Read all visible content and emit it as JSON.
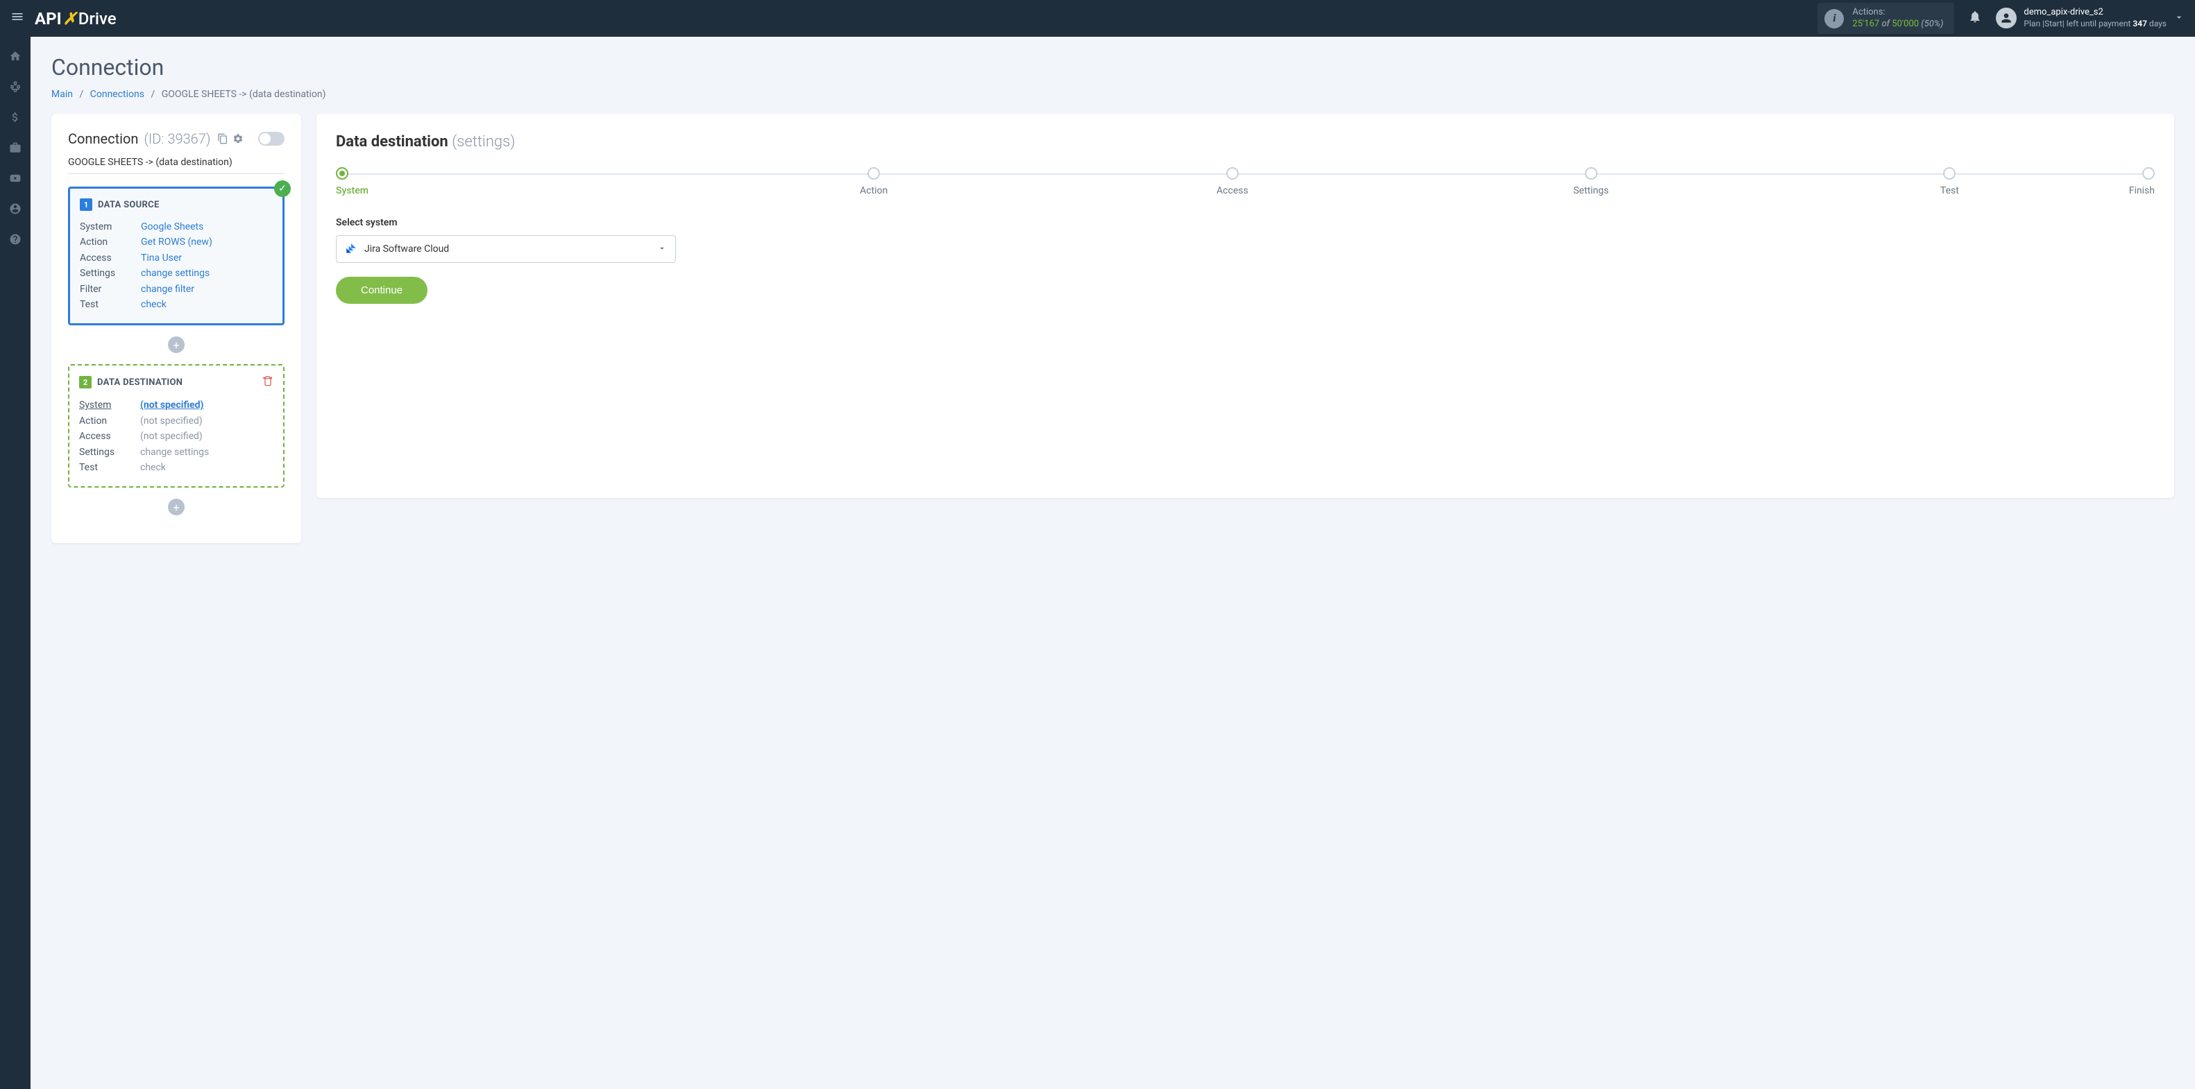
{
  "header": {
    "logo_api": "API",
    "logo_x": "X",
    "logo_drive": "Drive",
    "actions_label": "Actions:",
    "actions_count": "25'167",
    "actions_of": "of",
    "actions_total": "50'000",
    "actions_pct": "(50%)",
    "user_name": "demo_apix-drive_s2",
    "plan_prefix": "Plan |Start| left until payment",
    "plan_days": "347",
    "plan_days_suffix": "days"
  },
  "page": {
    "title": "Connection",
    "breadcrumb_main": "Main",
    "breadcrumb_connections": "Connections",
    "breadcrumb_current": "GOOGLE SHEETS -> (data destination)"
  },
  "conn_panel": {
    "title": "Connection",
    "id_label": "(ID: 39367)",
    "name": "GOOGLE SHEETS -> (data destination)",
    "source": {
      "num": "1",
      "title": "DATA SOURCE",
      "rows": [
        {
          "label": "System",
          "value": "Google Sheets"
        },
        {
          "label": "Action",
          "value": "Get ROWS (new)"
        },
        {
          "label": "Access",
          "value": "Tina User"
        },
        {
          "label": "Settings",
          "value": "change settings"
        },
        {
          "label": "Filter",
          "value": "change filter"
        },
        {
          "label": "Test",
          "value": "check"
        }
      ]
    },
    "dest": {
      "num": "2",
      "title": "DATA DESTINATION",
      "rows": [
        {
          "label": "System",
          "value": "(not specified)",
          "active": true
        },
        {
          "label": "Action",
          "value": "(not specified)"
        },
        {
          "label": "Access",
          "value": "(not specified)"
        },
        {
          "label": "Settings",
          "value": "change settings"
        },
        {
          "label": "Test",
          "value": "check"
        }
      ]
    }
  },
  "right": {
    "title": "Data destination",
    "subtitle": "(settings)",
    "steps": [
      "System",
      "Action",
      "Access",
      "Settings",
      "Test",
      "Finish"
    ],
    "field_label": "Select system",
    "selected": "Jira Software Cloud",
    "continue": "Continue"
  }
}
